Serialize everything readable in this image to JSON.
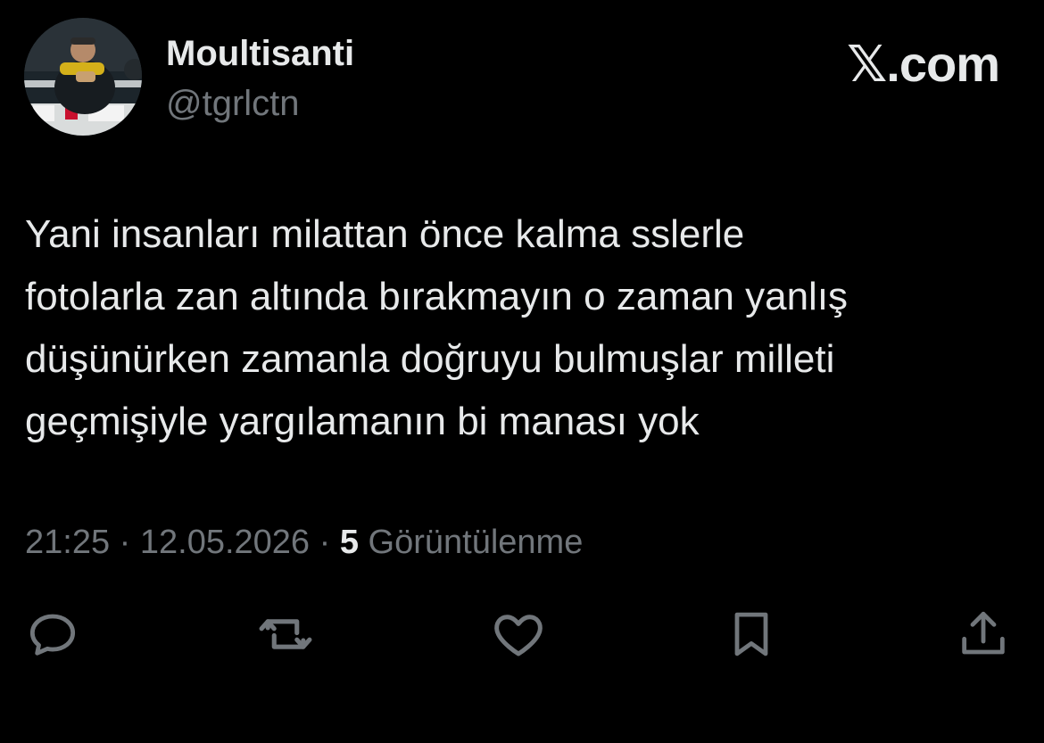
{
  "author": {
    "display_name": "Moultisanti",
    "handle": "@tgrlctn",
    "avatar": "profile-photo"
  },
  "brand": {
    "label": "𝕏.com"
  },
  "tweet": {
    "text": "Yani insanları milattan önce kalma sslerle\nfotolarla zan altında bırakmayın o zaman yanlış\ndüşünürken zamanla doğruyu bulmuşlar milleti\ngeçmişiyle yargılamanın bi manası yok",
    "time": "21:25",
    "separator": "·",
    "date": "12.05.2026",
    "views_count": "5",
    "views_label": "Görüntülenme"
  },
  "actions": [
    {
      "icon": "reply-icon"
    },
    {
      "icon": "retweet-icon"
    },
    {
      "icon": "like-icon"
    },
    {
      "icon": "bookmark-icon"
    },
    {
      "icon": "share-icon"
    }
  ],
  "colors": {
    "background": "#000000",
    "primary_text": "#e7e9ea",
    "secondary_text": "#71767b"
  }
}
